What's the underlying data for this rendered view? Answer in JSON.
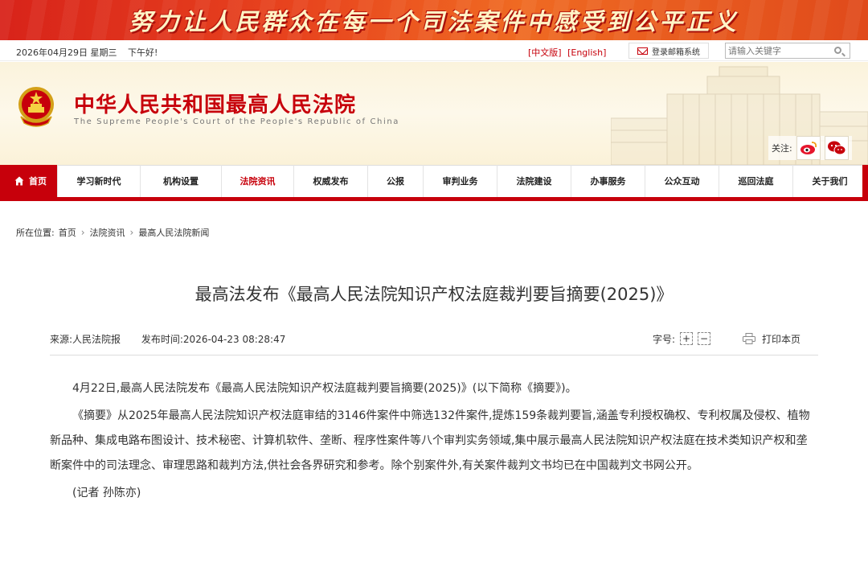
{
  "banner": {
    "slogan": "努力让人民群众在每一个司法案件中感受到公平正义"
  },
  "topbar": {
    "date": "2026年04月29日 星期三",
    "greeting": "下午好!",
    "lang_cn": "[中文版]",
    "lang_en": "[English]",
    "mail_label": "登录邮箱系统",
    "search_placeholder": "请输入关键字"
  },
  "header": {
    "court_name": "中华人民共和国最高人民法院",
    "court_name_en": "The Supreme People's Court of the People's Republic of China",
    "follow_label": "关注:"
  },
  "nav": {
    "items": [
      {
        "label": "首页"
      },
      {
        "label": "学习新时代"
      },
      {
        "label": "机构设置"
      },
      {
        "label": "法院资讯"
      },
      {
        "label": "权威发布"
      },
      {
        "label": "公报"
      },
      {
        "label": "审判业务"
      },
      {
        "label": "法院建设"
      },
      {
        "label": "办事服务"
      },
      {
        "label": "公众互动"
      },
      {
        "label": "巡回法庭"
      },
      {
        "label": "关于我们"
      }
    ]
  },
  "breadcrumb": {
    "prefix": "所在位置:",
    "items": [
      "首页",
      "法院资讯",
      "最高人民法院新闻"
    ]
  },
  "article": {
    "title": "最高法发布《最高人民法院知识产权法庭裁判要旨摘要(2025)》",
    "source": "来源:人民法院报",
    "publish_time": "发布时间:2026-04-23 08:28:47",
    "font_size_label": "字号:",
    "font_plus": "+",
    "font_minus": "−",
    "print_label": "打印本页",
    "paragraphs": [
      "4月22日,最高人民法院发布《最高人民法院知识产权法庭裁判要旨摘要(2025)》(以下简称《摘要》)。",
      "《摘要》从2025年最高人民法院知识产权法庭审结的3146件案件中筛选132件案件,提炼159条裁判要旨,涵盖专利授权确权、专利权属及侵权、植物新品种、集成电路布图设计、技术秘密、计算机软件、垄断、程序性案件等八个审判实务领域,集中展示最高人民法院知识产权法庭在技术类知识产权和垄断案件中的司法理念、审理思路和裁判方法,供社会各界研究和参考。除个别案件外,有关案件裁判文书均已在中国裁判文书网公开。",
      "(记者 孙陈亦)"
    ]
  },
  "colors": {
    "brand_red": "#c7000b",
    "header_bg": "#fbf3dc"
  },
  "icons": [
    "national-emblem-icon",
    "envelope-icon",
    "search-icon",
    "weibo-icon",
    "wechat-icon",
    "home-icon",
    "printer-icon"
  ]
}
